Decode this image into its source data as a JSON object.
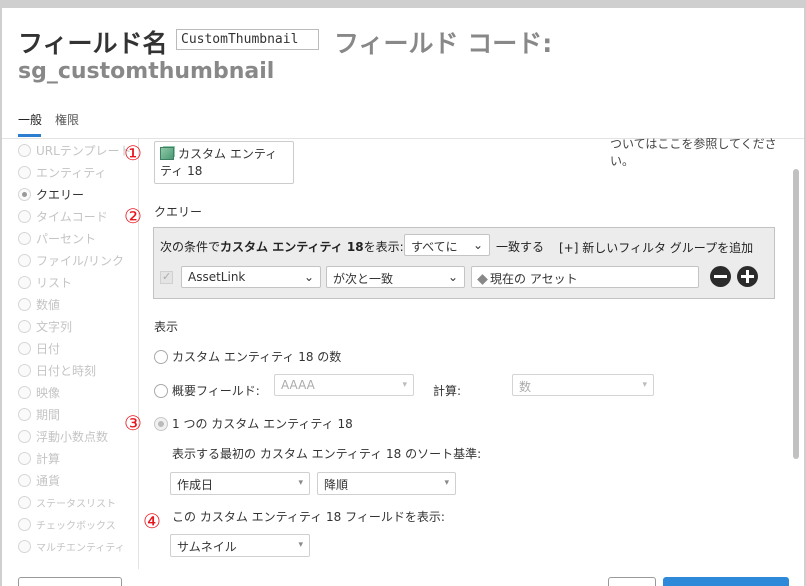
{
  "header": {
    "field_name_label": "フィールド名",
    "field_name_value": "CustomThumbnail",
    "field_code_label": "フィールド コード:",
    "field_code_value": "sg_customthumbnail"
  },
  "tabs": [
    {
      "label": "一般",
      "active": true
    },
    {
      "label": "権限",
      "active": false
    }
  ],
  "sidebar": {
    "items": [
      {
        "label": "URLテンプレート",
        "selected": false
      },
      {
        "label": "エンティティ",
        "selected": false
      },
      {
        "label": "クエリー",
        "selected": true
      },
      {
        "label": "タイムコード",
        "selected": false
      },
      {
        "label": "パーセント",
        "selected": false
      },
      {
        "label": "ファイル/リンク",
        "selected": false
      },
      {
        "label": "リスト",
        "selected": false
      },
      {
        "label": "数値",
        "selected": false
      },
      {
        "label": "文字列",
        "selected": false
      },
      {
        "label": "日付",
        "selected": false
      },
      {
        "label": "日付と時刻",
        "selected": false
      },
      {
        "label": "映像",
        "selected": false
      },
      {
        "label": "期間",
        "selected": false
      },
      {
        "label": "浮動小数点数",
        "selected": false
      },
      {
        "label": "計算",
        "selected": false
      },
      {
        "label": "通貨",
        "selected": false
      },
      {
        "label": "ステータスリスト",
        "selected": false
      },
      {
        "label": "チェックボックス",
        "selected": false
      },
      {
        "label": "マルチエンティティ",
        "selected": false
      }
    ]
  },
  "markers": [
    "①",
    "②",
    "③",
    "④"
  ],
  "entity": {
    "label": "カスタム エンティティ 18",
    "icon": "custom-entity-icon",
    "help_text": "ついてはここを参照してください。"
  },
  "query": {
    "section_label": "クエリー",
    "condition_prefix": "次の条件で",
    "condition_entity": "カスタム エンティティ 18",
    "condition_mid": "を表示:",
    "match_select": "すべてに",
    "match_suffix": "一致する",
    "add_filter_group": "[+] 新しいフィルタ グループを追加",
    "filter": {
      "field": "AssetLink",
      "operator": "が次と一致",
      "value": "現在の アセット"
    }
  },
  "display": {
    "section_label": "表示",
    "opt_count": "カスタム エンティティ 18 の数",
    "opt_summary": "概要フィールド:",
    "summary_select": "AAAA",
    "calc_label": "計算:",
    "calc_select": "数",
    "opt_single": "1 つの カスタム エンティティ 18",
    "sort_label": "表示する最初の カスタム エンティティ 18 のソート基準:",
    "sort_field": "作成日",
    "sort_order": "降順",
    "show_field_label": "この カスタム エンティティ 18 フィールドを表示:",
    "show_field_select": "サムネイル",
    "selected_option": "opt_single"
  },
  "colors": {
    "accent": "#2c7fd0",
    "marker_red": "#e8141c",
    "filter_bg": "#ececec"
  }
}
